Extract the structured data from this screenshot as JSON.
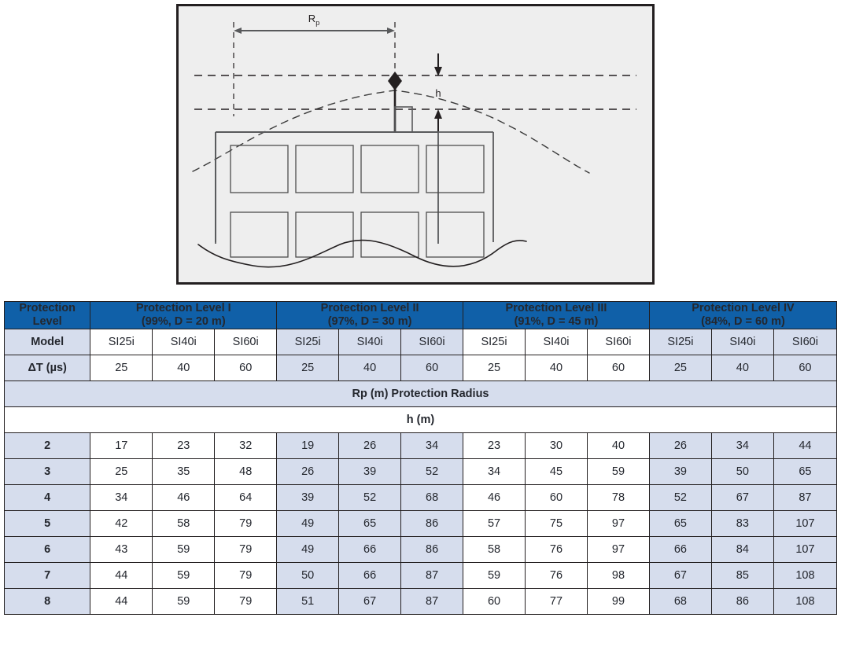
{
  "diagram": {
    "title_labels": {
      "radius": "R",
      "radius_sub": "p",
      "height": "h"
    },
    "colors": {
      "panel_bg": "#eeeeee",
      "panel_border": "#231f20",
      "line": "#58595b"
    },
    "description": "Lightning protection radius diagram: early streamer emission air terminal on a mast above a building, with protection radius Rp measured horizontally and height h measured from the structure top to the terminal tip."
  },
  "table": {
    "corner_label": "Protection\nLevel",
    "corner_label_line1": "Protection",
    "corner_label_line2": "Level",
    "groups": [
      {
        "title": "Protection Level I",
        "subtitle": "(99%, D = 20 m)",
        "shaded": false
      },
      {
        "title": "Protection Level II",
        "subtitle": "(97%, D = 30 m)",
        "shaded": true
      },
      {
        "title": "Protection Level III",
        "subtitle": "(91%, D = 45 m)",
        "shaded": false
      },
      {
        "title": "Protection Level IV",
        "subtitle": "(84%, D = 60 m)",
        "shaded": true
      }
    ],
    "model_row_label": "Model",
    "models": [
      "SI25i",
      "SI40i",
      "SI60i"
    ],
    "dt_row_label": "ΔT (µs)",
    "dt_values": [
      25,
      40,
      60
    ],
    "caption_rp": "Rp (m) Protection Radius",
    "caption_h": "h (m)",
    "colors": {
      "header_blue": "#1060a8",
      "shade_blue": "#d6dded",
      "border": "#231f20",
      "text": "#24272e"
    }
  },
  "chart_data": {
    "type": "table",
    "title": "Rp (m) Protection Radius",
    "xlabel": "h (m)",
    "ylabel": "Protection Radius Rp (m)",
    "row_header": "h (m)",
    "rows": [
      2,
      3,
      4,
      5,
      6,
      7,
      8
    ],
    "column_groups": [
      {
        "name": "Protection Level I",
        "probability": "99%",
        "D_m": 20,
        "models": [
          "SI25i",
          "SI40i",
          "SI60i"
        ],
        "delta_T_us": [
          25,
          40,
          60
        ],
        "values": [
          [
            17,
            23,
            32
          ],
          [
            25,
            35,
            48
          ],
          [
            34,
            46,
            64
          ],
          [
            42,
            58,
            79
          ],
          [
            43,
            59,
            79
          ],
          [
            44,
            59,
            79
          ],
          [
            44,
            59,
            79
          ]
        ]
      },
      {
        "name": "Protection Level II",
        "probability": "97%",
        "D_m": 30,
        "models": [
          "SI25i",
          "SI40i",
          "SI60i"
        ],
        "delta_T_us": [
          25,
          40,
          60
        ],
        "values": [
          [
            19,
            26,
            34
          ],
          [
            26,
            39,
            52
          ],
          [
            39,
            52,
            68
          ],
          [
            49,
            65,
            86
          ],
          [
            49,
            66,
            86
          ],
          [
            50,
            66,
            87
          ],
          [
            51,
            67,
            87
          ]
        ]
      },
      {
        "name": "Protection Level III",
        "probability": "91%",
        "D_m": 45,
        "models": [
          "SI25i",
          "SI40i",
          "SI60i"
        ],
        "delta_T_us": [
          25,
          40,
          60
        ],
        "values": [
          [
            23,
            30,
            40
          ],
          [
            34,
            45,
            59
          ],
          [
            46,
            60,
            78
          ],
          [
            57,
            75,
            97
          ],
          [
            58,
            76,
            97
          ],
          [
            59,
            76,
            98
          ],
          [
            60,
            77,
            99
          ]
        ]
      },
      {
        "name": "Protection Level IV",
        "probability": "84%",
        "D_m": 60,
        "models": [
          "SI25i",
          "SI40i",
          "SI60i"
        ],
        "delta_T_us": [
          25,
          40,
          60
        ],
        "values": [
          [
            26,
            34,
            44
          ],
          [
            39,
            50,
            65
          ],
          [
            52,
            67,
            87
          ],
          [
            65,
            83,
            107
          ],
          [
            66,
            84,
            107
          ],
          [
            67,
            85,
            108
          ],
          [
            68,
            86,
            108
          ]
        ]
      }
    ]
  }
}
